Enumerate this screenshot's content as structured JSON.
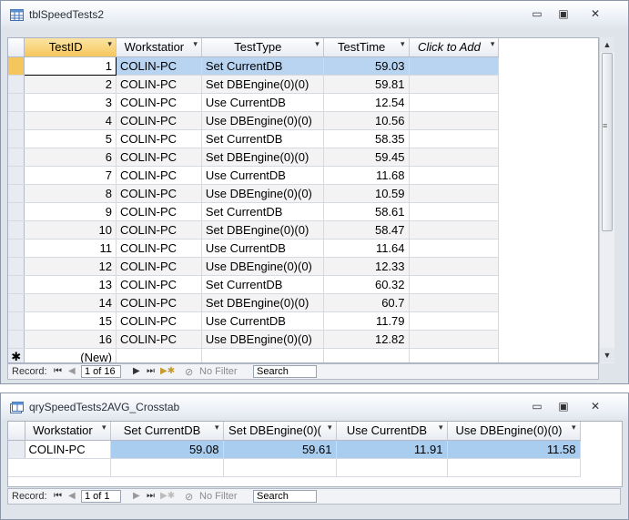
{
  "table_window": {
    "title": "tblSpeedTests2",
    "controls": {
      "minimize": "▭",
      "maximize": "▣",
      "close": "✕"
    },
    "columns": [
      "TestID",
      "Workstatior",
      "TestType",
      "TestTime",
      "Click to Add"
    ],
    "rows": [
      {
        "id": "1",
        "ws": "COLIN-PC",
        "type": "Set CurrentDB",
        "time": "59.03"
      },
      {
        "id": "2",
        "ws": "COLIN-PC",
        "type": "Set DBEngine(0)(0)",
        "time": "59.81"
      },
      {
        "id": "3",
        "ws": "COLIN-PC",
        "type": "Use CurrentDB",
        "time": "12.54"
      },
      {
        "id": "4",
        "ws": "COLIN-PC",
        "type": "Use DBEngine(0)(0)",
        "time": "10.56"
      },
      {
        "id": "5",
        "ws": "COLIN-PC",
        "type": "Set CurrentDB",
        "time": "58.35"
      },
      {
        "id": "6",
        "ws": "COLIN-PC",
        "type": "Set DBEngine(0)(0)",
        "time": "59.45"
      },
      {
        "id": "7",
        "ws": "COLIN-PC",
        "type": "Use CurrentDB",
        "time": "11.68"
      },
      {
        "id": "8",
        "ws": "COLIN-PC",
        "type": "Use DBEngine(0)(0)",
        "time": "10.59"
      },
      {
        "id": "9",
        "ws": "COLIN-PC",
        "type": "Set CurrentDB",
        "time": "58.61"
      },
      {
        "id": "10",
        "ws": "COLIN-PC",
        "type": "Set DBEngine(0)(0)",
        "time": "58.47"
      },
      {
        "id": "11",
        "ws": "COLIN-PC",
        "type": "Use CurrentDB",
        "time": "11.64"
      },
      {
        "id": "12",
        "ws": "COLIN-PC",
        "type": "Use DBEngine(0)(0)",
        "time": "12.33"
      },
      {
        "id": "13",
        "ws": "COLIN-PC",
        "type": "Set CurrentDB",
        "time": "60.32"
      },
      {
        "id": "14",
        "ws": "COLIN-PC",
        "type": "Set DBEngine(0)(0)",
        "time": "60.7"
      },
      {
        "id": "15",
        "ws": "COLIN-PC",
        "type": "Use CurrentDB",
        "time": "11.79"
      },
      {
        "id": "16",
        "ws": "COLIN-PC",
        "type": "Use DBEngine(0)(0)",
        "time": "12.82"
      }
    ],
    "new_row_marker": "✱",
    "new_row_label": "(New)",
    "nav": {
      "record_label": "Record:",
      "position": "1 of 16",
      "filter_label": "No Filter",
      "search_placeholder": "Search"
    }
  },
  "crosstab_window": {
    "title": "qrySpeedTests2AVG_Crosstab",
    "controls": {
      "minimize": "▭",
      "maximize": "▣",
      "close": "✕"
    },
    "columns": [
      "Workstatior",
      "Set CurrentDB",
      "Set DBEngine(0)(",
      "Use CurrentDB",
      "Use DBEngine(0)(0)"
    ],
    "rows": [
      {
        "ws": "COLIN-PC",
        "c1": "59.08",
        "c2": "59.61",
        "c3": "11.91",
        "c4": "11.58"
      }
    ],
    "nav": {
      "record_label": "Record:",
      "position": "1 of 1",
      "filter_label": "No Filter",
      "search_placeholder": "Search"
    }
  },
  "colors": {
    "selection_highlight": "#a9cdef",
    "row_selector_active": "#f5c65d"
  }
}
